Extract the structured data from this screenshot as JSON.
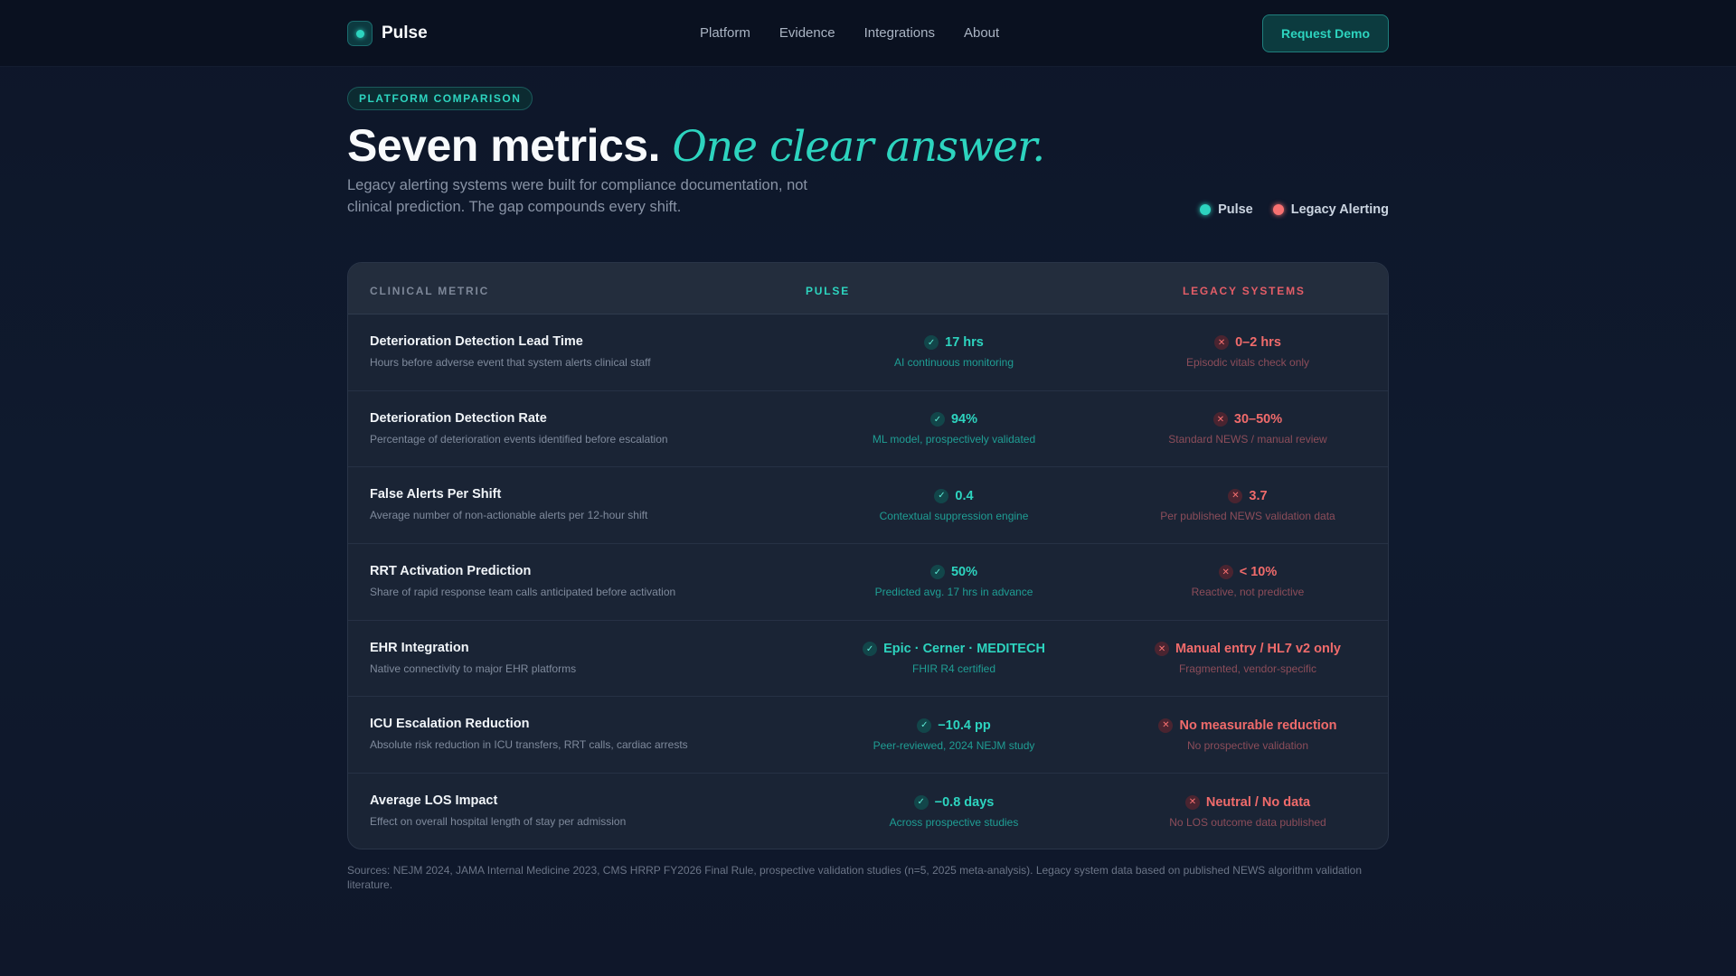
{
  "nav": {
    "brand": "Pulse",
    "links": [
      "Platform",
      "Evidence",
      "Integrations",
      "About"
    ],
    "cta": "Request Demo"
  },
  "hero": {
    "pill": "PLATFORM COMPARISON",
    "headline_main": "Seven metrics.",
    "headline_accent": "One clear answer.",
    "subtitle": "Legacy alerting systems were built for compliance documentation, not clinical prediction. The gap compounds every shift."
  },
  "legend": [
    {
      "label": "Pulse",
      "color": "#2dd4bf"
    },
    {
      "label": "Legacy Alerting",
      "color": "#f87171"
    }
  ],
  "table": {
    "headers": [
      "CLINICAL METRIC",
      "PULSE",
      "LEGACY SYSTEMS"
    ],
    "rows": [
      {
        "title": "Deterioration Detection Lead Time",
        "desc": "Hours before adverse event that system alerts clinical staff",
        "pulse_value": "17 hrs",
        "pulse_note": "AI continuous monitoring",
        "legacy_value": "0–2 hrs",
        "legacy_note": "Episodic vitals check only"
      },
      {
        "title": "Deterioration Detection Rate",
        "desc": "Percentage of deterioration events identified before escalation",
        "pulse_value": "94%",
        "pulse_note": "ML model, prospectively validated",
        "legacy_value": "30–50%",
        "legacy_note": "Standard NEWS / manual review"
      },
      {
        "title": "False Alerts Per Shift",
        "desc": "Average number of non-actionable alerts per 12-hour shift",
        "pulse_value": "0.4",
        "pulse_note": "Contextual suppression engine",
        "legacy_value": "3.7",
        "legacy_note": "Per published NEWS validation data"
      },
      {
        "title": "RRT Activation Prediction",
        "desc": "Share of rapid response team calls anticipated before activation",
        "pulse_value": "50%",
        "pulse_note": "Predicted avg. 17 hrs in advance",
        "legacy_value": "< 10%",
        "legacy_note": "Reactive, not predictive"
      },
      {
        "title": "EHR Integration",
        "desc": "Native connectivity to major EHR platforms",
        "pulse_value": "Epic · Cerner · MEDITECH",
        "pulse_note": "FHIR R4 certified",
        "legacy_value": "Manual entry / HL7 v2 only",
        "legacy_note": "Fragmented, vendor-specific"
      },
      {
        "title": "ICU Escalation Reduction",
        "desc": "Absolute risk reduction in ICU transfers, RRT calls, cardiac arrests",
        "pulse_value": "−10.4 pp",
        "pulse_note": "Peer-reviewed, 2024 NEJM study",
        "legacy_value": "No measurable reduction",
        "legacy_note": "No prospective validation"
      },
      {
        "title": "Average LOS Impact",
        "desc": "Effect on overall hospital length of stay per admission",
        "pulse_value": "−0.8 days",
        "pulse_note": "Across prospective studies",
        "legacy_value": "Neutral / No data",
        "legacy_note": "No LOS outcome data published"
      }
    ]
  },
  "sources": "Sources: NEJM 2024, JAMA Internal Medicine 2023, CMS HRRP FY2026 Final Rule, prospective validation studies (n=5, 2025 meta-analysis). Legacy system data based on published NEWS algorithm validation literature.",
  "colors": {
    "accent": "#2dd4bf",
    "legacy": "#f87171",
    "background": "#0f172a"
  },
  "icons": {
    "pulse": "check-icon",
    "legacy": "x-icon",
    "logo": "pulse-logo-icon"
  }
}
